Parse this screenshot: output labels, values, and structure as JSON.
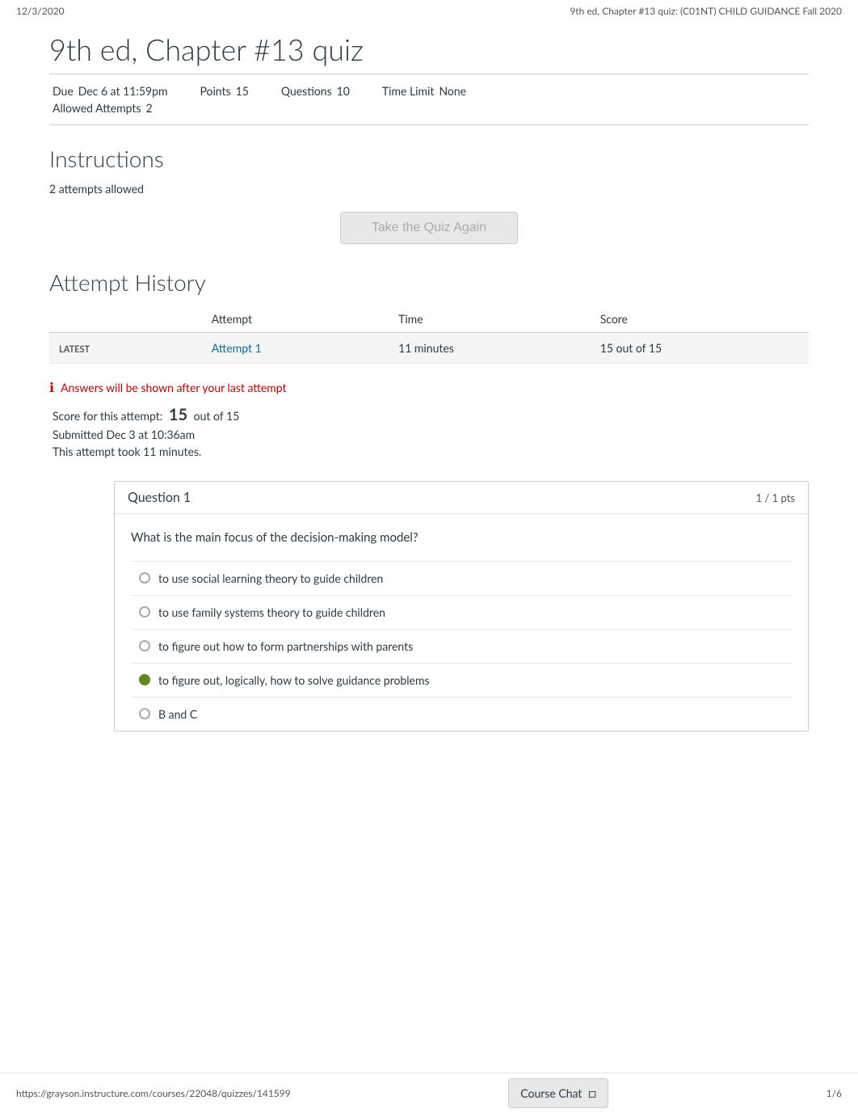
{
  "topBar": {
    "date": "12/3/2020",
    "title": "9th ed, Chapter #13 quiz: (C01NT) CHILD GUIDANCE Fall 2020"
  },
  "quizTitle": "9th ed, Chapter #13 quiz",
  "quizMeta": {
    "due": "Due",
    "dueValue": "Dec 6 at 11:59pm",
    "points": "Points",
    "pointsValue": "15",
    "questions": "Questions",
    "questionsValue": "10",
    "timeLimit": "Time Limit",
    "timeLimitValue": "None",
    "allowedAttempts": "Allowed Attempts",
    "allowedAttemptsValue": "2"
  },
  "instructions": {
    "sectionTitle": "Instructions",
    "bodyText": "2 attempts allowed"
  },
  "takeQuizBtn": "Take the Quiz Again",
  "attemptHistory": {
    "sectionTitle": "Attempt History",
    "columns": [
      "",
      "Attempt",
      "Time",
      "Score"
    ],
    "rows": [
      {
        "badge": "LATEST",
        "attempt": "Attempt 1",
        "time": "11 minutes",
        "score": "15 out of 15"
      }
    ]
  },
  "answerNotice": {
    "icon": "ℹ",
    "text": "Answers will be shown after your last attempt"
  },
  "scoreSummary": {
    "label": "Score for this attempt:",
    "scoreNumber": "15",
    "scoreOutOf": "out of 15",
    "submitted": "Submitted Dec 3 at 10:36am",
    "timeTaken": "This attempt took 11 minutes."
  },
  "question1": {
    "label": "Question 1",
    "points": "1 / 1 pts",
    "text": "What is the main focus of the decision-making model?",
    "options": [
      {
        "text": "to use social learning theory to guide children",
        "selected": false,
        "correct": false
      },
      {
        "text": "to use family systems theory to guide children",
        "selected": false,
        "correct": false
      },
      {
        "text": "to figure out how to form partnerships with parents",
        "selected": false,
        "correct": false
      },
      {
        "text": "to figure out, logically, how to solve guidance problems",
        "selected": false,
        "correct": true
      },
      {
        "text": "B and C",
        "selected": false,
        "correct": false
      }
    ]
  },
  "bottomBar": {
    "url": "https://grayson.instructure.com/courses/22048/quizzes/141599",
    "pagination": "1/6",
    "courseChatLabel": "Course Chat",
    "courseChatIcon": "□"
  }
}
